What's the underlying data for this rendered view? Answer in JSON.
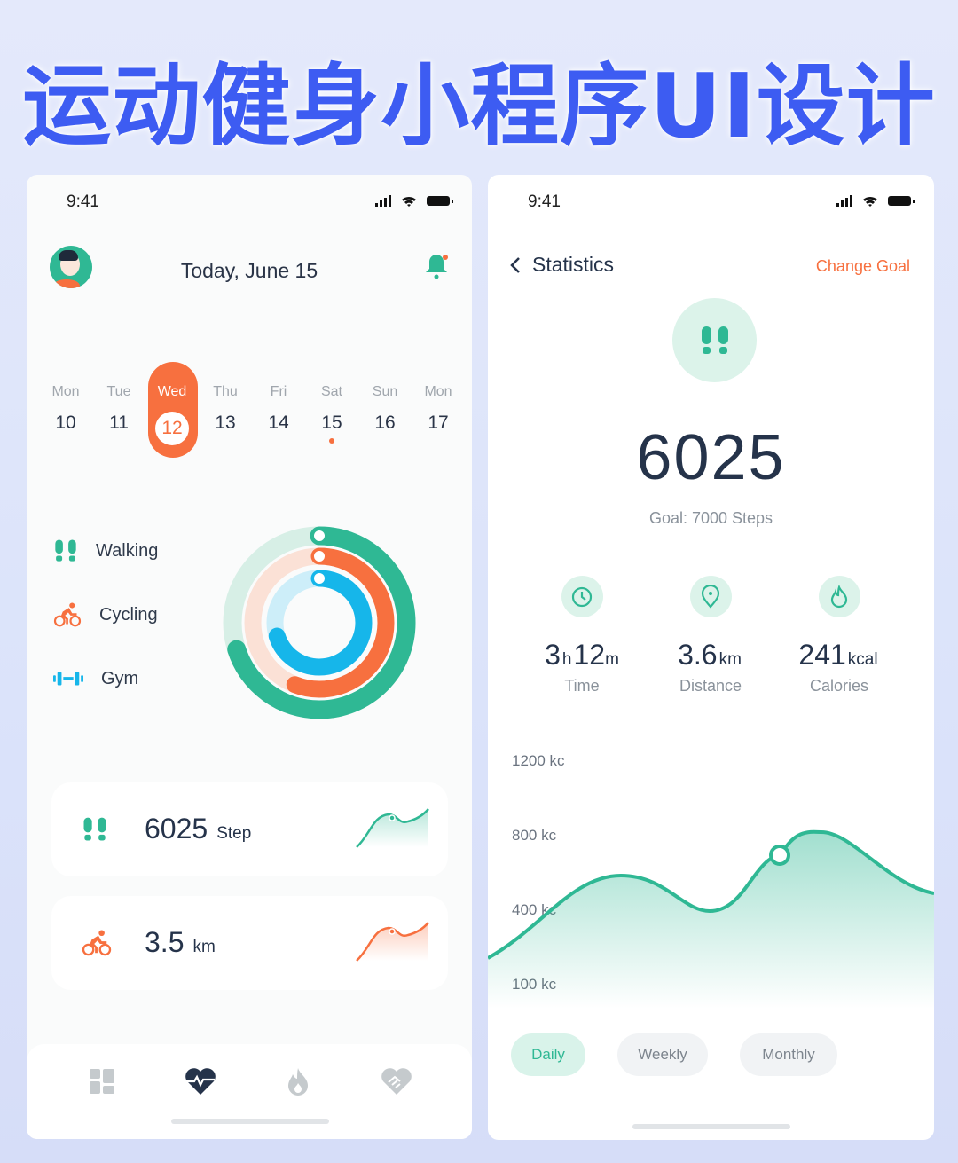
{
  "title": "运动健身小程序UI设计",
  "colors": {
    "green": "#2fb894",
    "orange": "#f7703f",
    "blue": "#16b6ea",
    "navy": "#25334a",
    "title_blue": "#3d5cf2"
  },
  "left": {
    "status_time": "9:41",
    "header_title": "Today, June 15",
    "days": [
      {
        "name": "Mon",
        "num": "10"
      },
      {
        "name": "Tue",
        "num": "11"
      },
      {
        "name": "Wed",
        "num": "12",
        "selected": true
      },
      {
        "name": "Thu",
        "num": "13"
      },
      {
        "name": "Fri",
        "num": "14"
      },
      {
        "name": "Sat",
        "num": "15",
        "dot": true
      },
      {
        "name": "Sun",
        "num": "16"
      },
      {
        "name": "Mon",
        "num": "17"
      }
    ],
    "legend": [
      {
        "label": "Walking",
        "icon": "footprints-icon",
        "progress": 0.7
      },
      {
        "label": "Cycling",
        "icon": "cycling-icon",
        "progress": 0.56
      },
      {
        "label": "Gym",
        "icon": "dumbbell-icon",
        "progress": 0.7
      }
    ],
    "cards": [
      {
        "value": "6025",
        "unit": "Step",
        "icon": "footprints-icon"
      },
      {
        "value": "3.5",
        "unit": "km",
        "icon": "cycling-icon"
      }
    ],
    "nav": [
      {
        "icon": "dashboard-icon"
      },
      {
        "icon": "heart-pulse-icon",
        "active": true
      },
      {
        "icon": "flame-icon"
      },
      {
        "icon": "heart-handshake-icon"
      }
    ]
  },
  "right": {
    "status_time": "9:41",
    "back_title": "Statistics",
    "change_goal": "Change Goal",
    "steps": "6025",
    "goal": "Goal: 7000 Steps",
    "stats": [
      {
        "icon": "clock-icon",
        "v1": "3",
        "u1": "h",
        "v2": "12",
        "u2": "m",
        "label": "Time"
      },
      {
        "icon": "location-pin-icon",
        "v1": "3.6",
        "u1": "km",
        "label": "Distance"
      },
      {
        "icon": "flame-icon",
        "v1": "241",
        "u1": "kcal",
        "label": "Calories"
      }
    ],
    "chart": {
      "y_labels": [
        "1200 kc",
        "800 kc",
        "400 kc",
        "100 kc"
      ]
    },
    "tabs": [
      {
        "label": "Daily",
        "active": true
      },
      {
        "label": "Weekly"
      },
      {
        "label": "Monthly"
      }
    ]
  }
}
